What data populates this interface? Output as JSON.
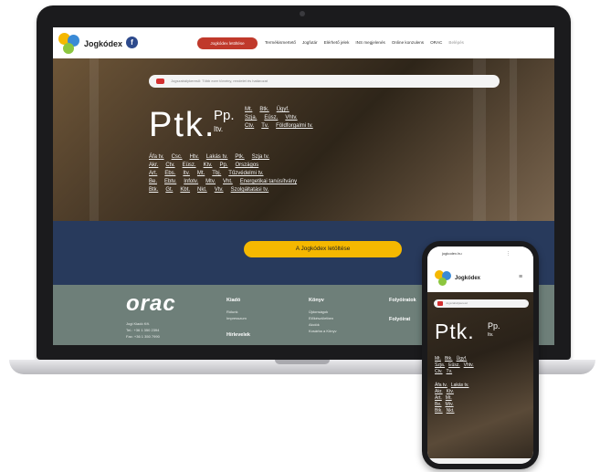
{
  "nav": {
    "brand": "Jogkódex",
    "fb": "f",
    "cta": "Jogkódex letöltése",
    "links": [
      "Termékismertető",
      "Jogfutár",
      "Elérhető jelek",
      "INS megjelenés",
      "Online konzulens",
      "ORAC"
    ],
    "muted_link": "Belépés"
  },
  "hero": {
    "search_placeholder": "Jogszabálykereső: Több ezer törvény, rendelet és határozat",
    "ptk": "Ptk.",
    "pp": "Pp.",
    "itv": "Itv.",
    "top_links": [
      [
        "Mt.",
        "Btk.",
        "Ügyf."
      ],
      [
        "Szja.",
        "Eüsz.",
        "Vhtv."
      ],
      [
        "Ctv.",
        "Tv.",
        "Földforgalmi tv."
      ]
    ],
    "links_row1": [
      "Áfa tv.",
      "Csc.",
      "Htv.",
      "Lakás tv.",
      "Ptk.",
      "Szja tv."
    ],
    "links_row2": [
      "Akr.",
      "Ctv.",
      "Eüsz.",
      "Ktv.",
      "Pp.",
      "Országos"
    ],
    "links_row3": [
      "Art.",
      "Ebs.",
      "Itv.",
      "Mt.",
      "Tbj.",
      "Tűzvédelmi tv."
    ],
    "links_row4": [
      "Be.",
      "Ebtv.",
      "Infotv.",
      "Mtv.",
      "Vht.",
      "Energetikai tanúsítvány"
    ],
    "links_row5": [
      "Btk.",
      "Gt.",
      "Kbt.",
      "Nkt.",
      "Vtv.",
      "Szolgáltatási tv."
    ]
  },
  "navy": {
    "cta": "A Jogkódex letöltése"
  },
  "footer": {
    "logo": "orac",
    "address": [
      "Jogi Kiadó Kft.",
      "Tel.: +36 1 350 2394",
      "Fax: +36 1 350 7990"
    ],
    "col1": {
      "head": "Kiadó",
      "items": [
        "Rólunk",
        "Impresszum"
      ]
    },
    "col1b": {
      "head": "Hírlevelek"
    },
    "col2": {
      "head": "Könyv",
      "items": [
        "Újdonságok",
        "Előkészületben",
        "Akciók",
        "Kosárba a Könyv"
      ]
    },
    "col3": {
      "head": "Folyóiratok"
    },
    "col3b": {
      "head": "Folyóirat"
    }
  },
  "phone": {
    "url": "jogkodex.hu",
    "tools": "⋮",
    "brand": "Jogkódex",
    "menu": "≡",
    "search_placeholder": "Jogszabálykereső",
    "ptk": "Ptk.",
    "pp": "Pp.",
    "itv": "Itv.",
    "links": [
      [
        "Mt.",
        "Btk.",
        "Ügyf."
      ],
      [
        "Szja.",
        "Eüsz.",
        "Vhtv."
      ],
      [
        "Ctv.",
        "Tv."
      ],
      [
        "Áfa tv.",
        "Lakás tv."
      ],
      [
        "Akr.",
        "Ktv."
      ],
      [
        "Art.",
        "Mt."
      ],
      [
        "Be.",
        "Mtv."
      ],
      [
        "Btk.",
        "Nkt."
      ]
    ]
  },
  "colors": {
    "red": "#c0392b",
    "navy": "#283a5c",
    "yellow": "#f5b800",
    "footer": "#6e7f79"
  }
}
